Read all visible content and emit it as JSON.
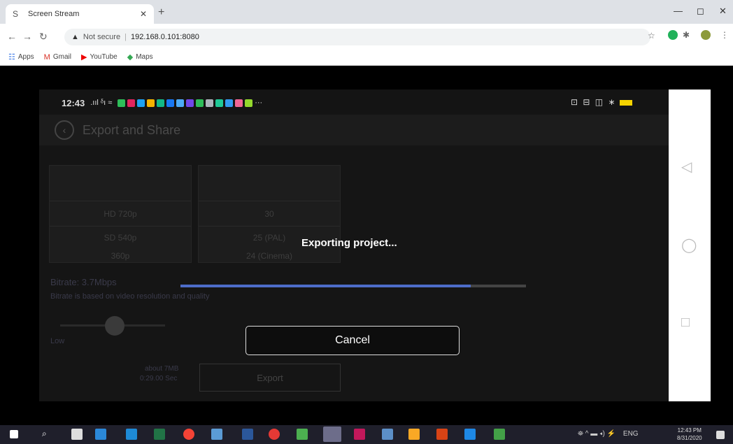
{
  "browser": {
    "tab_title": "Screen Stream",
    "tab_icon": "S",
    "url_warning": "Not secure",
    "url": "192.168.0.101:8080",
    "bookmarks": [
      {
        "label": "Apps",
        "icon": "☷",
        "color": "#3b78e7"
      },
      {
        "label": "Gmail",
        "icon": "M",
        "color": "#d93025"
      },
      {
        "label": "YouTube",
        "icon": "▶",
        "color": "#e00"
      },
      {
        "label": "Maps",
        "icon": "◆",
        "color": "#34a853"
      }
    ]
  },
  "phone": {
    "status_time": "12:43",
    "status_signal": ".ııl ᵟı ≈",
    "status_right": "⊡ ⊟ ◫ ∗",
    "app_title": "Export and Share",
    "resolution_options": [
      "HD 720p",
      "SD 540p",
      "360p"
    ],
    "framerate_options": [
      "30",
      "25 (PAL)",
      "24 (Cinema)"
    ],
    "bitrate_label": "Bitrate: 3.7Mbps",
    "bitrate_desc": "Bitrate is based on video resolution and quality",
    "low_label": "Low",
    "size_label": "about 7MB",
    "time_label": "0:29.00 Sec",
    "export_label": "Export"
  },
  "dialog": {
    "title": "Exporting project...",
    "progress": 0.84,
    "cancel_label": "Cancel"
  },
  "sidenav": {
    "back_icon": "◁",
    "home_icon": "◯",
    "recents_icon": "□"
  },
  "taskbar": {
    "time": "12:43 PM",
    "date": "8/31/2020",
    "lang": "ENG"
  }
}
